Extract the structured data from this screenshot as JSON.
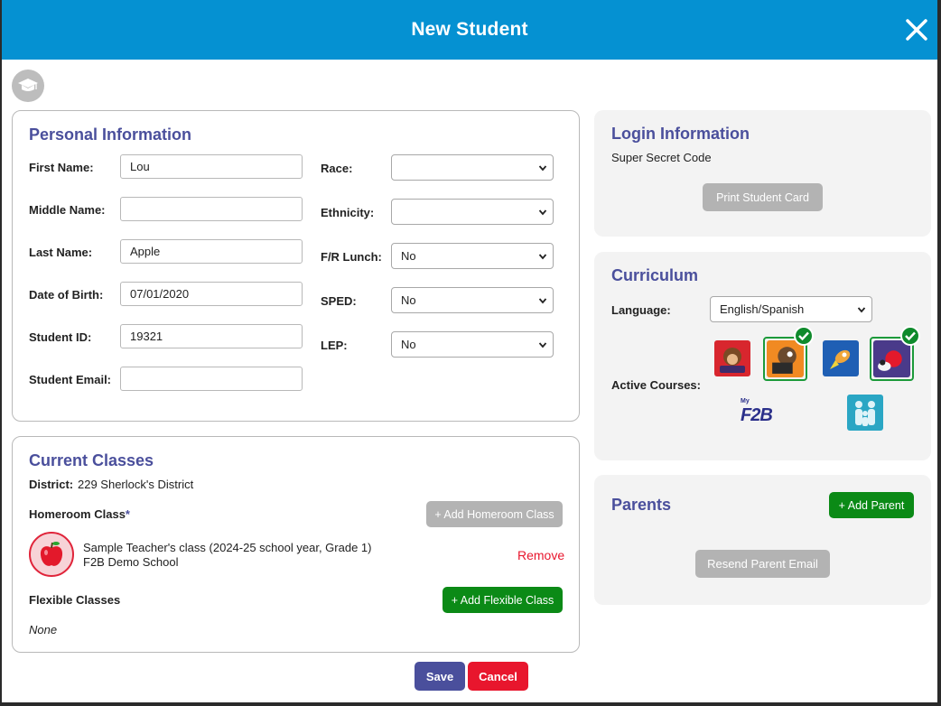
{
  "dialog": {
    "title": "New Student",
    "close_icon": "close-icon"
  },
  "avatar_icon": "graduation-cap-icon",
  "personal": {
    "title": "Personal Information",
    "fields": {
      "first_name": {
        "label": "First Name:",
        "value": "Lou"
      },
      "middle_name": {
        "label": "Middle Name:",
        "value": ""
      },
      "last_name": {
        "label": "Last Name:",
        "value": "Apple"
      },
      "dob": {
        "label": "Date of Birth:",
        "value": "07/01/2020"
      },
      "student_id": {
        "label": "Student ID:",
        "value": "19321"
      },
      "email": {
        "label": "Student Email:",
        "value": ""
      }
    },
    "selects": {
      "race": {
        "label": "Race:",
        "value": ""
      },
      "ethnicity": {
        "label": "Ethnicity:",
        "value": ""
      },
      "fr_lunch": {
        "label": "F/R Lunch:",
        "value": "No"
      },
      "sped": {
        "label": "SPED:",
        "value": "No"
      },
      "lep": {
        "label": "LEP:",
        "value": "No"
      }
    }
  },
  "classes": {
    "title": "Current Classes",
    "district_label": "District:",
    "district_value": "229 Sherlock's District",
    "homeroom_label": "Homeroom Class",
    "required_mark": "*",
    "add_homeroom": "+ Add Homeroom Class",
    "homeroom_class_name": "Sample Teacher's class (2024-25 school year, Grade 1)",
    "homeroom_school": "F2B Demo School",
    "remove": "Remove",
    "flexible_label": "Flexible Classes",
    "add_flexible": "+ Add Flexible Class",
    "flexible_value": "None"
  },
  "login": {
    "title": "Login Information",
    "code": "Super Secret Code",
    "print_card": "Print Student Card"
  },
  "curriculum": {
    "title": "Curriculum",
    "language_label": "Language:",
    "language_value": "English/Spanish",
    "active_courses_label": "Active Courses:",
    "brand_mark": "My",
    "brand_letters": "F2B"
  },
  "parents": {
    "title": "Parents",
    "add_parent": "+ Add Parent",
    "resend_email": "Resend Parent Email"
  },
  "footer": {
    "save": "Save",
    "cancel": "Cancel"
  },
  "colors": {
    "header": "#0591d2",
    "accent": "#4a4f9c",
    "green": "#0b8a16",
    "red": "#e8162d",
    "gray_button": "#b3b3b3"
  }
}
